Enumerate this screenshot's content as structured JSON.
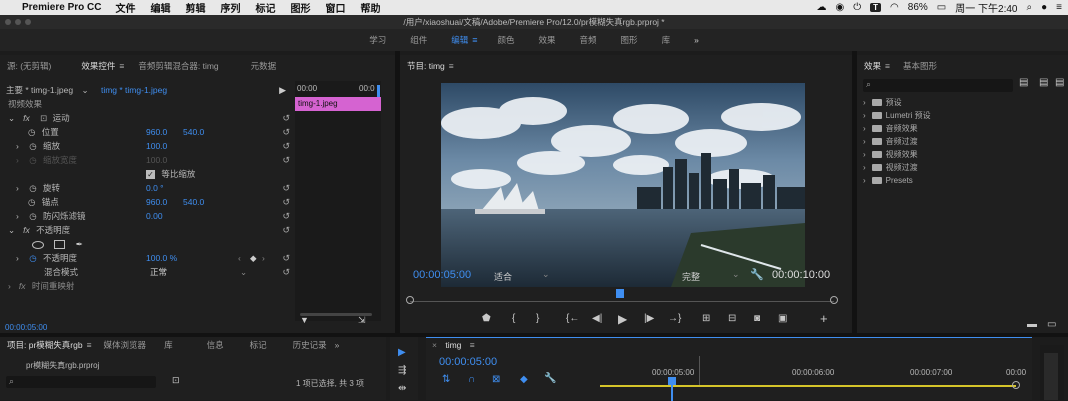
{
  "menubar": {
    "app": "Premiere Pro CC",
    "items": [
      "文件",
      "编辑",
      "剪辑",
      "序列",
      "标记",
      "图形",
      "窗口",
      "帮助"
    ],
    "battery": "86%",
    "clock": "周一 下午2:40",
    "tbox": "T"
  },
  "titlebar": {
    "path": "/用户/xiaoshuai/文稿/Adobe/Premiere Pro/12.0/pr模糊失真rgb.prproj *"
  },
  "workspaces": [
    "学习",
    "组件",
    "编辑",
    "颜色",
    "效果",
    "音频",
    "图形",
    "库"
  ],
  "workspace_more": "»",
  "effect_controls": {
    "tabs": [
      "源: (无剪辑)",
      "效果控件",
      "音频剪辑混合器: timg",
      "元数据"
    ],
    "master": "主要 * timg-1.jpeg",
    "sequence_clip": "timg * timg-1.jpeg",
    "timecode_start": "00:00",
    "timecode_end": "00:0",
    "clip_label": "timg-1.jpeg",
    "section_video": "视频效果",
    "fx_motion": "运动",
    "position": {
      "label": "位置",
      "x": "960.0",
      "y": "540.0"
    },
    "scale": {
      "label": "缩放",
      "value": "100.0"
    },
    "scale_width": {
      "label": "缩放宽度",
      "value": "100.0"
    },
    "uniform_scale": "等比缩放",
    "rotation": {
      "label": "旋转",
      "value": "0.0 °"
    },
    "anchor": {
      "label": "锚点",
      "x": "960.0",
      "y": "540.0"
    },
    "antiflicker": {
      "label": "防闪烁滤镜",
      "value": "0.00"
    },
    "fx_opacity": "不透明度",
    "opacity": {
      "label": "不透明度",
      "value": "100.0 %"
    },
    "blend": {
      "label": "混合模式",
      "value": "正常"
    },
    "time_remap": "时间重映射",
    "bottom_tc": "00:00:05:00"
  },
  "program": {
    "tab": "节目: timg",
    "timecode": "00:00:05:00",
    "fit": "适合",
    "quality": "完整",
    "duration": "00:00:10:00"
  },
  "effects_panel": {
    "tabs": [
      "效果",
      "基本图形"
    ],
    "items": [
      "预设",
      "Lumetri 预设",
      "音频效果",
      "音频过渡",
      "视频效果",
      "视频过渡",
      "Presets"
    ]
  },
  "project": {
    "tabs": [
      "项目: pr模糊失真rgb",
      "媒体浏览器",
      "库",
      "信息",
      "标记",
      "历史记录"
    ],
    "file": "pr模糊失真rgb.prproj",
    "status": "1 项已选择, 共 3 项"
  },
  "timeline": {
    "tab": "timg",
    "timecode": "00:00:05:00",
    "ruler": [
      "00:00:05:00",
      "00:00:06:00",
      "00:00:07:00",
      "00:00"
    ]
  },
  "colors": {
    "accent": "#3f8ef0",
    "clip": "#d563d1",
    "timeline_bar": "#d5c42a"
  }
}
